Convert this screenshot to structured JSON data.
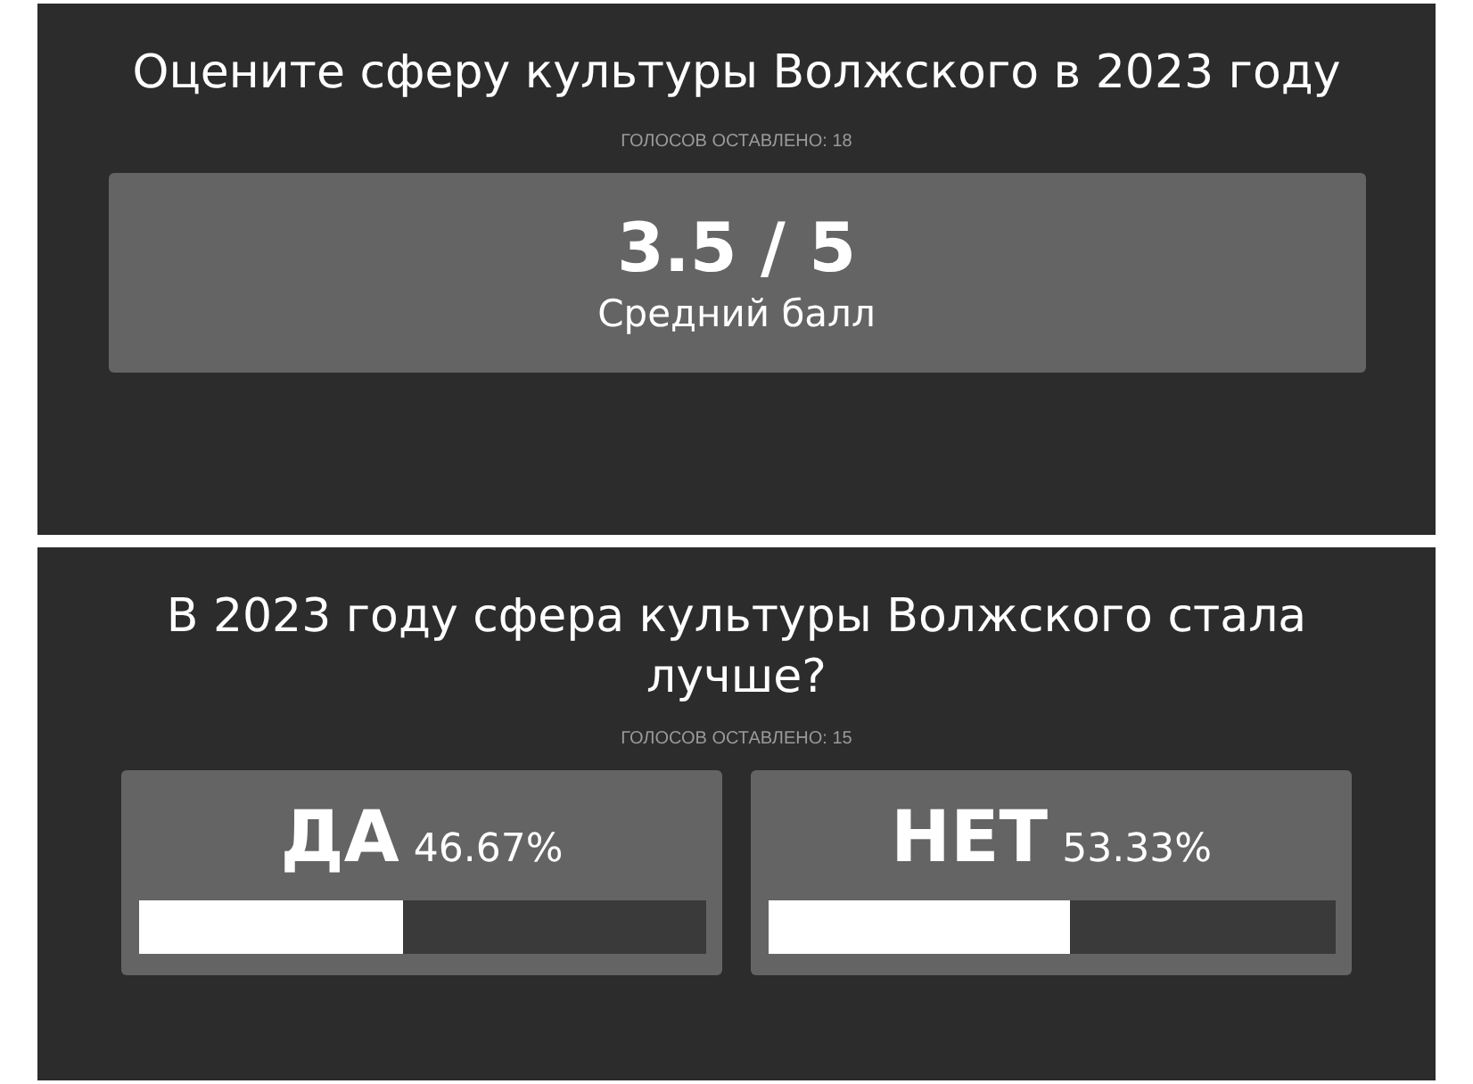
{
  "rating_poll": {
    "title": "Оцените сферу культуры Волжского в 2023 году",
    "votes": "ГОЛОСОВ ОСТАВЛЕНО: 18",
    "score": "3.5 / 5",
    "score_label": "Средний балл"
  },
  "yes_no_poll": {
    "title": "В 2023 году сфера культуры Волжского стала лучше?",
    "votes": "ГОЛОСОВ ОСТАВЛЕНО: 15",
    "options": [
      {
        "label": "ДА",
        "percent": "46.67%",
        "level": 0.4667
      },
      {
        "label": "НЕТ",
        "percent": "53.33%",
        "level": 0.5333
      }
    ]
  }
}
